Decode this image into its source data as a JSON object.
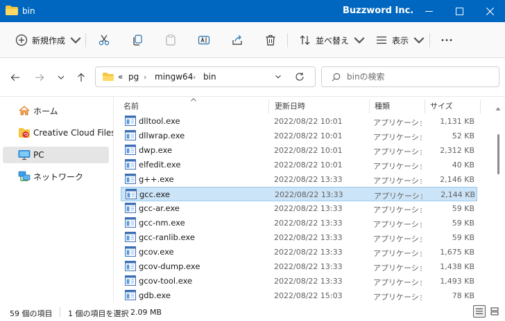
{
  "window": {
    "title": "bin",
    "brand": "Buzzword Inc.",
    "colors": {
      "titlebar": "#0067c0",
      "selection": "#cce4f7",
      "folder": "#f4c542",
      "accent_selection_border": "#99c9ef"
    }
  },
  "toolbar": {
    "new_label": "新規作成",
    "sort_label": "並べ替え",
    "view_label": "表示",
    "icons": [
      "plus-circle-icon",
      "cut-icon",
      "copy-icon",
      "paste-icon",
      "rename-icon",
      "share-icon",
      "delete-icon",
      "sort-icon",
      "view-icon",
      "more-icon"
    ]
  },
  "address": {
    "overflow": "«",
    "crumbs": [
      "pg",
      "mingw64",
      "bin"
    ],
    "separator": "›"
  },
  "search": {
    "placeholder": "binの検索"
  },
  "sidebar": {
    "items": [
      {
        "label": "ホーム",
        "icon": "home-icon"
      },
      {
        "label": "Creative Cloud Files",
        "icon": "creative-cloud-icon"
      },
      {
        "label": "PC",
        "icon": "pc-icon",
        "selected": true
      },
      {
        "label": "ネットワーク",
        "icon": "network-icon"
      }
    ]
  },
  "columns": {
    "name": "名前",
    "date": "更新日時",
    "type": "種類",
    "size": "サイズ"
  },
  "files": [
    {
      "name": "dlltool.exe",
      "date": "2022/08/22 10:01",
      "type": "アプリケーション",
      "size": "1,131 KB"
    },
    {
      "name": "dllwrap.exe",
      "date": "2022/08/22 10:01",
      "type": "アプリケーション",
      "size": "52 KB"
    },
    {
      "name": "dwp.exe",
      "date": "2022/08/22 10:01",
      "type": "アプリケーション",
      "size": "2,312 KB"
    },
    {
      "name": "elfedit.exe",
      "date": "2022/08/22 10:01",
      "type": "アプリケーション",
      "size": "40 KB"
    },
    {
      "name": "g++.exe",
      "date": "2022/08/22 13:33",
      "type": "アプリケーション",
      "size": "2,146 KB"
    },
    {
      "name": "gcc.exe",
      "date": "2022/08/22 13:33",
      "type": "アプリケーション",
      "size": "2,144 KB",
      "selected": true
    },
    {
      "name": "gcc-ar.exe",
      "date": "2022/08/22 13:33",
      "type": "アプリケーション",
      "size": "59 KB"
    },
    {
      "name": "gcc-nm.exe",
      "date": "2022/08/22 13:33",
      "type": "アプリケーション",
      "size": "59 KB"
    },
    {
      "name": "gcc-ranlib.exe",
      "date": "2022/08/22 13:33",
      "type": "アプリケーション",
      "size": "59 KB"
    },
    {
      "name": "gcov.exe",
      "date": "2022/08/22 13:33",
      "type": "アプリケーション",
      "size": "1,675 KB"
    },
    {
      "name": "gcov-dump.exe",
      "date": "2022/08/22 13:33",
      "type": "アプリケーション",
      "size": "1,438 KB"
    },
    {
      "name": "gcov-tool.exe",
      "date": "2022/08/22 13:33",
      "type": "アプリケーション",
      "size": "1,493 KB"
    },
    {
      "name": "gdb.exe",
      "date": "2022/08/22 15:03",
      "type": "アプリケーション",
      "size": "78 KB"
    }
  ],
  "status": {
    "count": "59 個の項目",
    "selection": "1 個の項目を選択",
    "selection_size": "2.09 MB"
  }
}
